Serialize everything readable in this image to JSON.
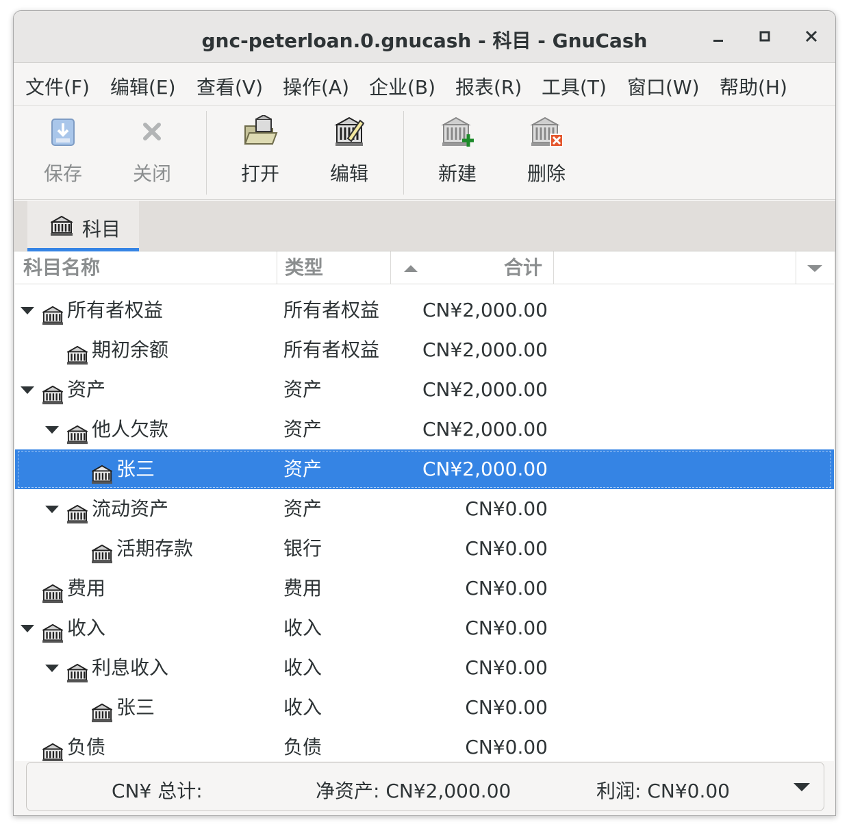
{
  "window": {
    "title": "gnc-peterloan.0.gnucash - 科目 - GnuCash"
  },
  "menubar": {
    "items": [
      "文件(F)",
      "编辑(E)",
      "查看(V)",
      "操作(A)",
      "企业(B)",
      "报表(R)",
      "工具(T)",
      "窗口(W)",
      "帮助(H)"
    ]
  },
  "toolbar": {
    "save_label": "保存",
    "close_label": "关闭",
    "open_label": "打开",
    "edit_label": "编辑",
    "new_label": "新建",
    "delete_label": "删除"
  },
  "tabs": [
    {
      "label": "科目",
      "icon": "account-icon"
    }
  ],
  "tree": {
    "columns": {
      "name": "科目名称",
      "type": "类型",
      "total": "合计"
    },
    "rows": [
      {
        "name": "所有者权益",
        "type": "所有者权益",
        "total": "CN¥2,000.00",
        "level": 0,
        "expanded": true
      },
      {
        "name": "期初余额",
        "type": "所有者权益",
        "total": "CN¥2,000.00",
        "level": 1,
        "expanded": false
      },
      {
        "name": "资产",
        "type": "资产",
        "total": "CN¥2,000.00",
        "level": 0,
        "expanded": true
      },
      {
        "name": "他人欠款",
        "type": "资产",
        "total": "CN¥2,000.00",
        "level": 1,
        "expanded": true
      },
      {
        "name": "张三",
        "type": "资产",
        "total": "CN¥2,000.00",
        "level": 2,
        "expanded": false,
        "selected": true
      },
      {
        "name": "流动资产",
        "type": "资产",
        "total": "CN¥0.00",
        "level": 1,
        "expanded": true
      },
      {
        "name": "活期存款",
        "type": "银行",
        "total": "CN¥0.00",
        "level": 2,
        "expanded": false
      },
      {
        "name": "费用",
        "type": "费用",
        "total": "CN¥0.00",
        "level": 0,
        "expanded": false
      },
      {
        "name": "收入",
        "type": "收入",
        "total": "CN¥0.00",
        "level": 0,
        "expanded": true
      },
      {
        "name": "利息收入",
        "type": "收入",
        "total": "CN¥0.00",
        "level": 1,
        "expanded": true
      },
      {
        "name": "张三",
        "type": "收入",
        "total": "CN¥0.00",
        "level": 2,
        "expanded": false
      },
      {
        "name": "负债",
        "type": "负债",
        "total": "CN¥0.00",
        "level": 0,
        "expanded": false
      }
    ]
  },
  "summary": {
    "currency_total": "CN¥ 总计:",
    "net_assets": "净资产: CN¥2,000.00",
    "profit": "利润: CN¥0.00"
  },
  "colors": {
    "selection": "#3584e4",
    "tab_indicator": "#3584e4"
  }
}
